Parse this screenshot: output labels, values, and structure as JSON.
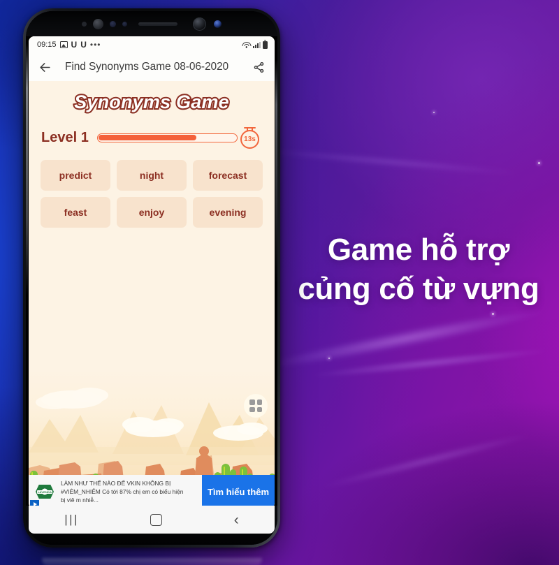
{
  "background": {
    "gradient_from": "#1a3bbf",
    "gradient_to": "#a315b2"
  },
  "marketing": {
    "line1": "Game hỗ trợ",
    "line2": "củng cố từ vựng",
    "color": "#ffffff"
  },
  "phone": {
    "status_bar": {
      "time": "09:15",
      "icons_left": [
        "image-icon",
        "u-icon",
        "u-icon",
        "more-dots-icon"
      ],
      "icons_right": [
        "wifi-icon",
        "signal-icon",
        "battery-icon"
      ]
    },
    "app_bar": {
      "back_icon": "arrow-left-icon",
      "title": "Find Synonyms Game 08-06-2020",
      "share_icon": "share-icon"
    },
    "game": {
      "title": "Synonyms Game",
      "title_color": "#8c2f22",
      "level_label": "Level 1",
      "progress_percent": 72,
      "timer_value": "13s",
      "timer_color": "#f2663c",
      "tiles": [
        {
          "word": "predict"
        },
        {
          "word": "night"
        },
        {
          "word": "forecast"
        },
        {
          "word": "feast"
        },
        {
          "word": "enjoy"
        },
        {
          "word": "evening"
        }
      ],
      "grid_button_icon": "grid-apps-icon",
      "background_color": "#fdf3e4",
      "tile_color": "#f8e3cd"
    },
    "ad": {
      "advertiser_logo": "LAVENDA",
      "adchoices_icon": "adchoices-icon",
      "line1": "LÀM NHƯ THẾ NÀO ĐỂ VKIN KHÔNG BỊ",
      "line2": "#VIÊM_NHIỄM Có tới 87% chị em có biểu hiện",
      "line3": "bị viê m nhiễ...",
      "cta_label": "Tìm hiểu thêm",
      "cta_color": "#1a73e8"
    },
    "nav_bar": {
      "recents_icon": "recents-icon",
      "recents_glyph": "|||",
      "home_icon": "home-icon",
      "back_icon": "back-chevron-icon",
      "back_glyph": "‹"
    }
  }
}
